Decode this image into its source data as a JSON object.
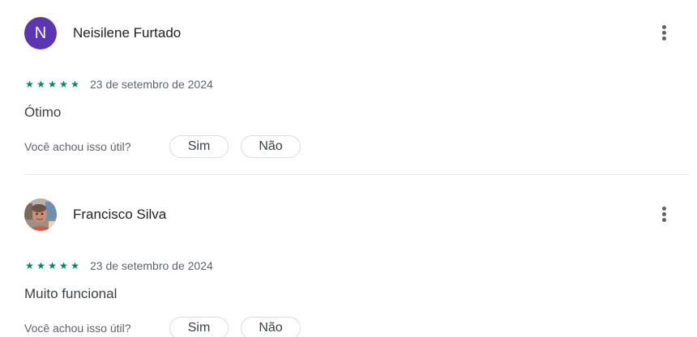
{
  "reviews": [
    {
      "avatar_letter": "N",
      "avatar_color": "#5e35b1",
      "author": "Neisilene Furtado",
      "rating": 5,
      "stars": [
        "★",
        "★",
        "★",
        "★",
        "★"
      ],
      "date": "23 de setembro de 2024",
      "text": "Ótimo",
      "helpful_question": "Você achou isso útil?",
      "yes_label": "Sim",
      "no_label": "Não"
    },
    {
      "avatar_letter": "",
      "author": "Francisco Silva",
      "rating": 5,
      "stars": [
        "★",
        "★",
        "★",
        "★",
        "★"
      ],
      "date": "23 de setembro de 2024",
      "text": "Muito funcional",
      "helpful_question": "Você achou isso útil?",
      "yes_label": "Sim",
      "no_label": "Não"
    }
  ],
  "colors": {
    "star": "#01875f",
    "more_icon": "#5f6368",
    "divider": "#e8eaed"
  },
  "icons": {
    "more": "more-vert-icon",
    "star": "star-icon"
  }
}
